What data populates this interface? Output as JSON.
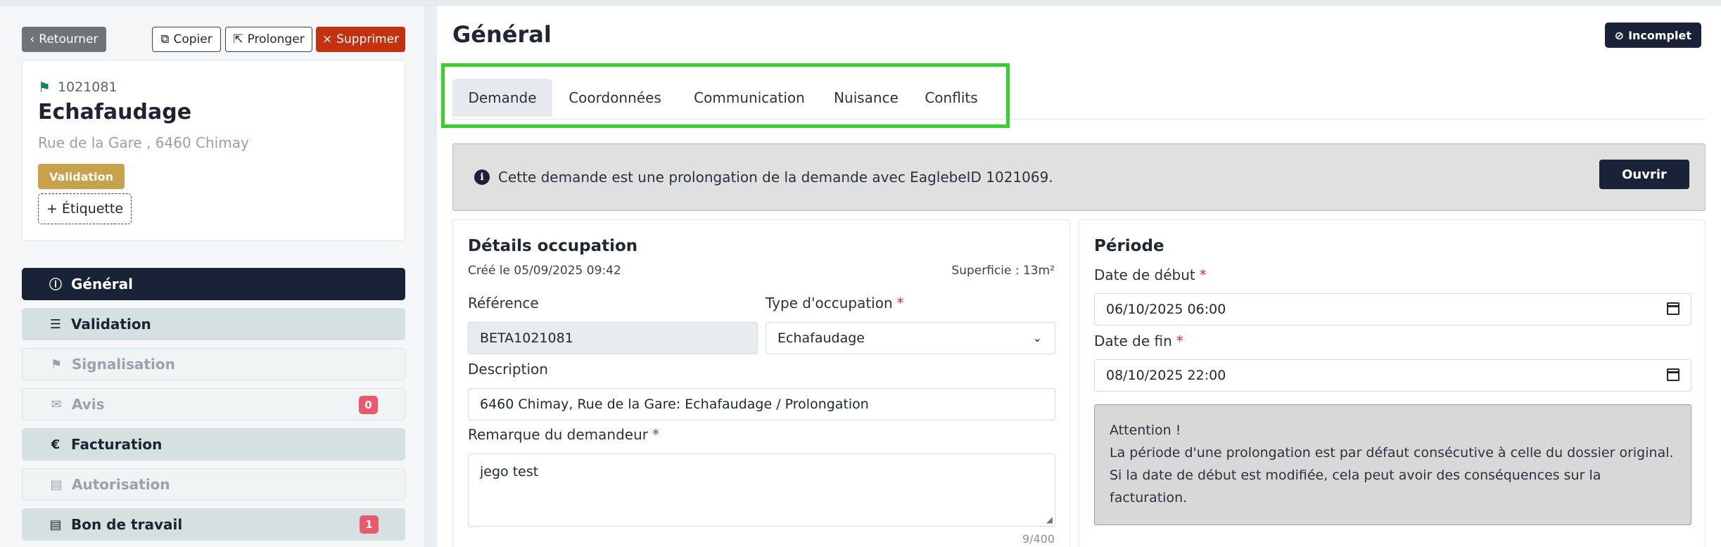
{
  "toolbar": {
    "back_label": "Retourner",
    "copy_label": "Copier",
    "prolong_label": "Prolonger",
    "delete_label": "Supprimer"
  },
  "record": {
    "id": "1021081",
    "title": "Echafaudage",
    "address": "Rue de la Gare , 6460 Chimay",
    "status_badge": "Validation",
    "add_tag_label": "+ Étiquette"
  },
  "sidebar": {
    "items": [
      {
        "label": "Général",
        "icon": "info-icon",
        "state": "active"
      },
      {
        "label": "Validation",
        "icon": "checklist-icon",
        "state": "enabled"
      },
      {
        "label": "Signalisation",
        "icon": "signpost-icon",
        "state": "disabled"
      },
      {
        "label": "Avis",
        "icon": "comment-icon",
        "state": "disabled",
        "count": "0"
      },
      {
        "label": "Facturation",
        "icon": "euro-icon",
        "state": "enabled"
      },
      {
        "label": "Autorisation",
        "icon": "file-check-icon",
        "state": "disabled"
      },
      {
        "label": "Bon de travail",
        "icon": "document-icon",
        "state": "enabled",
        "count": "1"
      }
    ]
  },
  "header": {
    "title": "Général",
    "status": "Incomplet"
  },
  "tabs": [
    "Demande",
    "Coordonnées",
    "Communication",
    "Nuisance",
    "Conflits"
  ],
  "info": {
    "message": "Cette demande est une prolongation de la demande avec EaglebeID 1021069.",
    "open_label": "Ouvrir"
  },
  "details": {
    "title": "Détails occupation",
    "created": "Créé le 05/09/2025 09:42",
    "area": "Superficie : 13m²",
    "reference_label": "Référence",
    "reference_value": "BETA1021081",
    "type_label": "Type d'occupation",
    "type_value": "Echafaudage",
    "description_label": "Description",
    "description_value": "6460 Chimay, Rue de la Gare: Echafaudage / Prolongation",
    "remark_label": "Remarque du demandeur",
    "remark_value": "jego test",
    "remark_counter": "9/400",
    "required_mark": "*"
  },
  "period": {
    "title": "Période",
    "start_label": "Date de début",
    "start_value": "06/10/2025 06:00",
    "end_label": "Date de fin",
    "end_value": "08/10/2025 22:00",
    "warning_title": "Attention !",
    "warning_text": "La période d'une prolongation est par défaut consécutive à celle du dossier original. Si la date de début est modifiée, cela peut avoir des conséquences sur la facturation."
  },
  "colors": {
    "accent_dark": "#1a2238",
    "delete_red": "#c4310f",
    "validation_gold": "#c7a24a",
    "highlight_green": "#35d32a",
    "count_red": "#e95a6c"
  }
}
